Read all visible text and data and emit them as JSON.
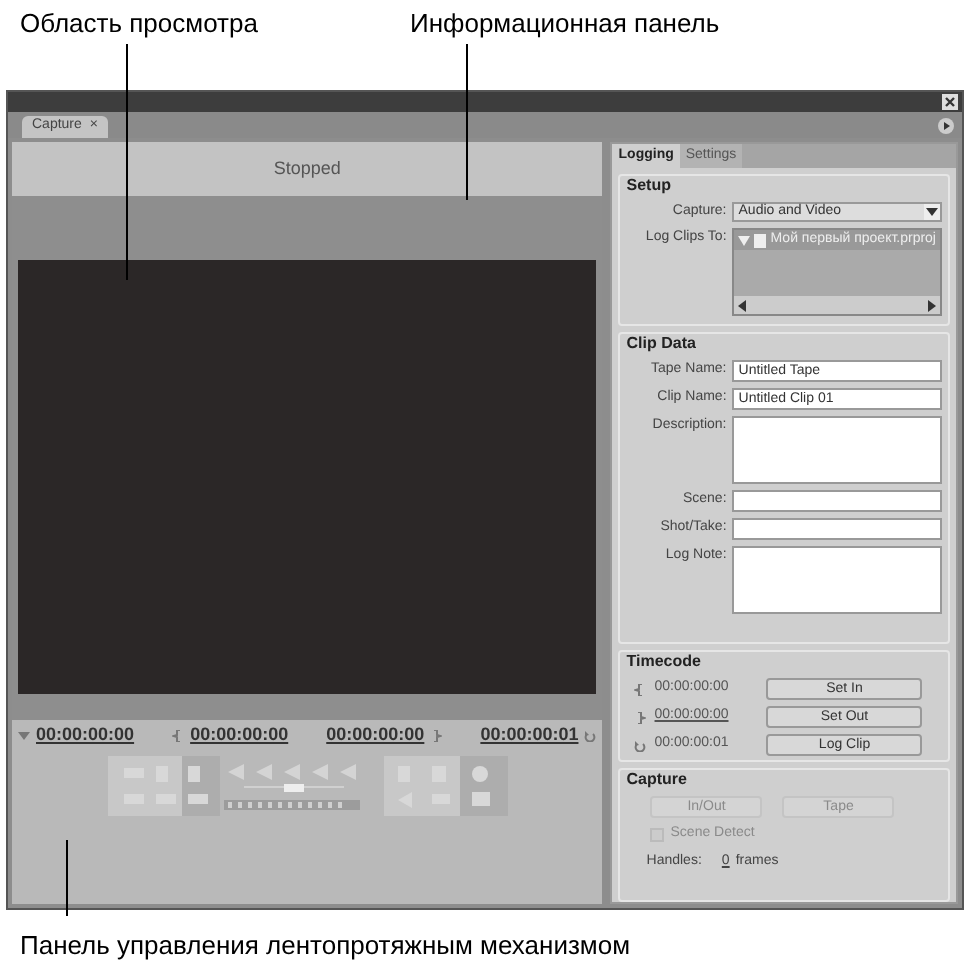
{
  "annotations": [
    {
      "text": "Область просмотра"
    },
    {
      "text": "Информационная панель"
    },
    {
      "text": "Панель управления лентопротяжным механизмом"
    }
  ],
  "tabs": [
    {
      "label": "Capture",
      "close": "×",
      "selected": true
    }
  ],
  "info": {
    "status": "Stopped"
  },
  "timecodes": [
    {
      "kind": "current",
      "value": "00:00:00:00"
    },
    {
      "kind": "in",
      "value": "00:00:00:00"
    },
    {
      "kind": "out",
      "value": "00:00:00:00"
    },
    {
      "kind": "duration",
      "value": "00:00:00:01"
    }
  ],
  "panel_tabs": [
    {
      "label": "Logging",
      "selected": true
    },
    {
      "label": "Settings",
      "selected": false
    }
  ],
  "setup": {
    "title": "Setup",
    "capture_label": "Capture:",
    "capture_value": "Audio and Video",
    "log_label": "Log Clips To:",
    "log_items": [
      {
        "label": "Мой первый проект.prproj"
      }
    ]
  },
  "clip_data": {
    "title": "Clip Data",
    "fields": [
      {
        "kind": "line",
        "label": "Tape Name:",
        "value": "Untitled Tape"
      },
      {
        "kind": "line",
        "label": "Clip Name:",
        "value": "Untitled Clip 01"
      },
      {
        "kind": "area",
        "label": "Description:"
      },
      {
        "kind": "line",
        "label": "Scene:"
      },
      {
        "kind": "line",
        "label": "Shot/Take:"
      },
      {
        "kind": "area",
        "label": "Log Note:"
      }
    ]
  },
  "timecode": {
    "title": "Timecode",
    "rows": [
      {
        "kind": "in",
        "value": "00:00:00:00",
        "button": "Set In"
      },
      {
        "kind": "out",
        "value": "00:00:00:00",
        "button": "Set Out"
      },
      {
        "kind": "duration",
        "value": "00:00:00:01",
        "button": "Log Clip"
      }
    ]
  },
  "capture": {
    "title": "Capture",
    "buttons": [
      {
        "label": "In/Out",
        "disabled": true
      },
      {
        "label": "Tape",
        "disabled": true
      }
    ],
    "scene_detect": {
      "label": "Scene Detect",
      "checked": false,
      "disabled": true
    },
    "handles_label": "Handles:",
    "handles_value": "0",
    "handles_unit": "frames"
  }
}
